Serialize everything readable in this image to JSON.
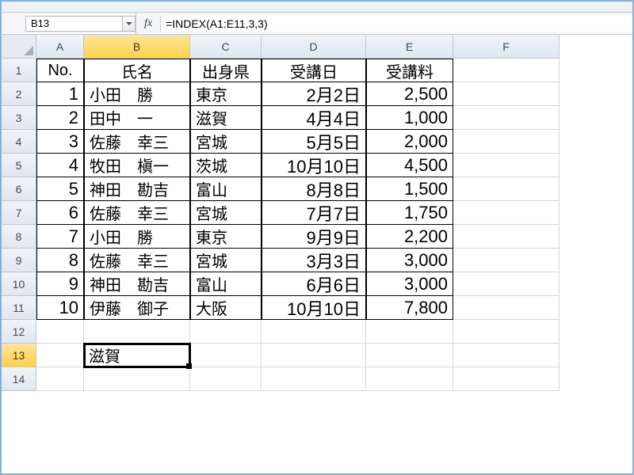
{
  "name_box": "B13",
  "formula": "=INDEX(A1:E11,3,3)",
  "fx_label": "fx",
  "columns": [
    "A",
    "B",
    "C",
    "D",
    "E",
    "F"
  ],
  "selected_col": "B",
  "selected_row": "13",
  "result_cell_value": "滋賀",
  "chart_data": {
    "type": "table",
    "headers": [
      "No.",
      "氏名",
      "出身県",
      "受講日",
      "受講料"
    ],
    "rows": [
      {
        "no": "1",
        "name": "小田　勝",
        "pref": "東京",
        "date": "2月2日",
        "fee": "2,500"
      },
      {
        "no": "2",
        "name": "田中　一",
        "pref": "滋賀",
        "date": "4月4日",
        "fee": "1,000"
      },
      {
        "no": "3",
        "name": "佐藤　幸三",
        "pref": "宮城",
        "date": "5月5日",
        "fee": "2,000"
      },
      {
        "no": "4",
        "name": "牧田　槇一",
        "pref": "茨城",
        "date": "10月10日",
        "fee": "4,500"
      },
      {
        "no": "5",
        "name": "神田　勘吉",
        "pref": "富山",
        "date": "8月8日",
        "fee": "1,500"
      },
      {
        "no": "6",
        "name": "佐藤　幸三",
        "pref": "宮城",
        "date": "7月7日",
        "fee": "1,750"
      },
      {
        "no": "7",
        "name": "小田　勝",
        "pref": "東京",
        "date": "9月9日",
        "fee": "2,200"
      },
      {
        "no": "8",
        "name": "佐藤　幸三",
        "pref": "宮城",
        "date": "3月3日",
        "fee": "3,000"
      },
      {
        "no": "9",
        "name": "神田　勘吉",
        "pref": "富山",
        "date": "6月6日",
        "fee": "3,000"
      },
      {
        "no": "10",
        "name": "伊藤　御子",
        "pref": "大阪",
        "date": "10月10日",
        "fee": "7,800"
      }
    ]
  },
  "row_count": 14
}
